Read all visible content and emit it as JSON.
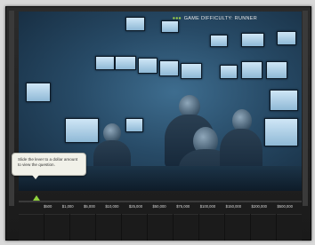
{
  "header": {
    "difficulty_dots": "●●●",
    "difficulty_text": "GAME DIFFICULTY: RUNNER"
  },
  "tooltip": {
    "text": "Slide the lever to a dollar amount to view the question."
  },
  "amounts": [
    "$500",
    "$1,000",
    "$5,000",
    "$10,000",
    "$25,000",
    "$50,000",
    "$75,000",
    "$100,000",
    "$150,000",
    "$200,000",
    "$500,000"
  ],
  "colors": {
    "accent": "#8fd13c",
    "frame": "#1f1f1f",
    "scene": "#274a66"
  }
}
